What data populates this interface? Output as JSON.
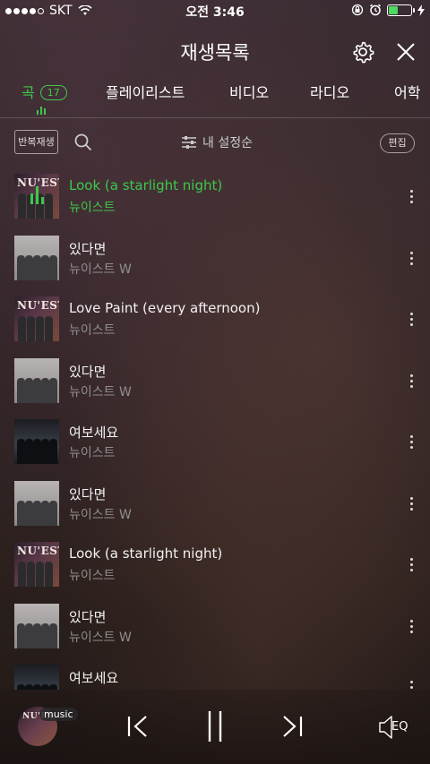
{
  "status_bar": {
    "carrier": "SKT",
    "time": "오전 3:46",
    "battery_percent": 40
  },
  "header": {
    "title": "재생목록"
  },
  "tabs": [
    {
      "label": "곡",
      "badge": "17",
      "active": true
    },
    {
      "label": "플레이리스트"
    },
    {
      "label": "비디오"
    },
    {
      "label": "라디오"
    },
    {
      "label": "어학"
    }
  ],
  "toolbar": {
    "repeat_label": "반복재생",
    "sort_label": "내 설정순",
    "edit_label": "편집"
  },
  "songs": [
    {
      "title": "Look (a starlight night)",
      "artist": "뉴이스트",
      "cover": "nuest",
      "playing": true
    },
    {
      "title": "있다면",
      "artist": "뉴이스트 W",
      "cover": "w"
    },
    {
      "title": "Love Paint (every afternoon)",
      "artist": "뉴이스트",
      "cover": "nuest"
    },
    {
      "title": "있다면",
      "artist": "뉴이스트 W",
      "cover": "w"
    },
    {
      "title": "여보세요",
      "artist": "뉴이스트",
      "cover": "yeoboseyo"
    },
    {
      "title": "있다면",
      "artist": "뉴이스트 W",
      "cover": "w"
    },
    {
      "title": "Look (a starlight night)",
      "artist": "뉴이스트",
      "cover": "nuest"
    },
    {
      "title": "있다면",
      "artist": "뉴이스트 W",
      "cover": "w"
    },
    {
      "title": "여보세요",
      "artist": "",
      "cover": "yeoboseyo"
    }
  ],
  "cover_logo": "NU'EST",
  "player": {
    "badge": "music",
    "eq_label": "EQ"
  },
  "colors": {
    "accent": "#3ec84a",
    "battery": "#4cd964"
  }
}
